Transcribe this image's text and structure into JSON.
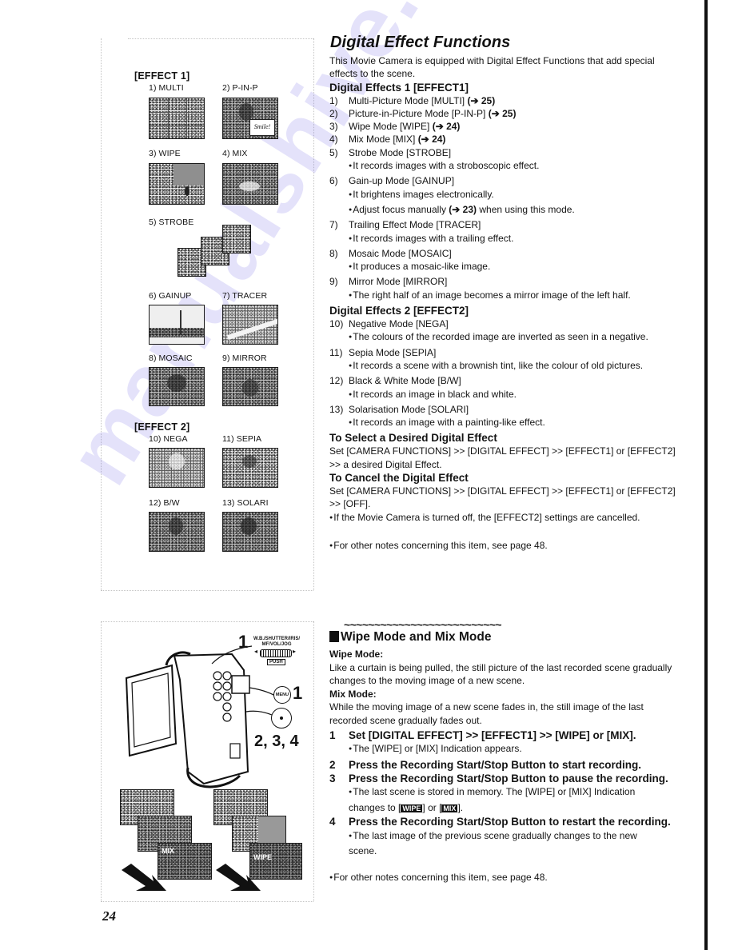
{
  "page_number": "24",
  "watermark": "manualshive.com",
  "left_panel": {
    "effect1_title": "[EFFECT 1]",
    "effect2_title": "[EFFECT 2]",
    "thumbnails": [
      {
        "label": "1) MULTI"
      },
      {
        "label": "2) P-IN-P",
        "inset_text": "Smile!"
      },
      {
        "label": "3) WIPE"
      },
      {
        "label": "4) MIX"
      },
      {
        "label": "5) STROBE"
      },
      {
        "label": "6) GAINUP"
      },
      {
        "label": "7) TRACER"
      },
      {
        "label": "8) MOSAIC"
      },
      {
        "label": "9) MIRROR"
      },
      {
        "label": "10) NEGA"
      },
      {
        "label": "11) SEPIA"
      },
      {
        "label": "12) B/W"
      },
      {
        "label": "13) SOLARI"
      }
    ]
  },
  "camera_diagram": {
    "callout_1_top": "1",
    "dial_label": "W.B./SHUTTER/IRIS/ MF/VOL/JOG",
    "push_label": "PUSH",
    "menu_button": "MENU",
    "callout_menu": "1",
    "callout_record": "2, 3, 4",
    "mix_overlay": "MIX",
    "wipe_overlay": "WIPE"
  },
  "main": {
    "title": "Digital Effect Functions",
    "intro": "This Movie Camera is equipped with Digital Effect Functions that add special effects to the scene.",
    "effects1_heading": "Digital Effects 1 [EFFECT1]",
    "effects1": [
      {
        "num": "1)",
        "text": "Multi-Picture Mode [MULTI] ",
        "ref": "(➔ 25)"
      },
      {
        "num": "2)",
        "text": "Picture-in-Picture Mode [P-IN-P] ",
        "ref": "(➔ 25)"
      },
      {
        "num": "3)",
        "text": "Wipe Mode [WIPE] ",
        "ref": "(➔ 24)"
      },
      {
        "num": "4)",
        "text": "Mix Mode [MIX] ",
        "ref": "(➔ 24)"
      },
      {
        "num": "5)",
        "text": "Strobe Mode [STROBE]",
        "notes": [
          "It records images with a stroboscopic effect."
        ]
      },
      {
        "num": "6)",
        "text": "Gain-up Mode [GAINUP]",
        "notes": [
          "It brightens images electronically."
        ],
        "note_focus_pre": "Adjust focus manually ",
        "note_focus_ref": "(➔ 23)",
        "note_focus_post": " when using this mode."
      },
      {
        "num": "7)",
        "text": "Trailing Effect Mode [TRACER]",
        "notes": [
          "It records images with a trailing effect."
        ]
      },
      {
        "num": "8)",
        "text": "Mosaic Mode [MOSAIC]",
        "notes": [
          "It produces a mosaic-like image."
        ]
      },
      {
        "num": "9)",
        "text": "Mirror Mode [MIRROR]",
        "notes": [
          "The right half of an image becomes a mirror image of the left half."
        ]
      }
    ],
    "effects2_heading": "Digital Effects 2  [EFFECT2]",
    "effects2": [
      {
        "num": "10)",
        "text": "Negative Mode [NEGA]",
        "note": "The colours of the recorded image are inverted as seen in a negative."
      },
      {
        "num": "11)",
        "text": "Sepia Mode [SEPIA]",
        "note": "It records a scene with a brownish tint, like the colour of old pictures."
      },
      {
        "num": "12)",
        "text": "Black & White Mode [B/W]",
        "note": "It records an image in black and white."
      },
      {
        "num": "13)",
        "text": "Solarisation Mode [SOLARI]",
        "note": "It records an image with a painting-like effect."
      }
    ],
    "select_heading": "To Select a Desired Digital Effect",
    "select_text": "Set [CAMERA FUNCTIONS] >> [DIGITAL EFFECT] >> [EFFECT1] or [EFFECT2] >> a desired Digital Effect.",
    "cancel_heading": "To Cancel the Digital Effect",
    "cancel_text": "Set [CAMERA FUNCTIONS] >> [DIGITAL EFFECT] >> [EFFECT1] or [EFFECT2] >> [OFF].",
    "cancel_note": "If the Movie Camera is turned off, the [EFFECT2] settings are cancelled.",
    "other_notes": "For other notes concerning this item, see page 48."
  },
  "wipe_mix": {
    "divider": "~~~~~~~~~~~~~~~~~~~~~~~~~~",
    "title": "Wipe Mode and Mix Mode",
    "wipe_heading": "Wipe Mode:",
    "wipe_text": "Like a curtain is being pulled, the still picture of the last recorded scene gradually changes to the moving image of a new scene.",
    "mix_heading": "Mix Mode:",
    "mix_text": "While the moving image of a new scene fades in, the still image of the last recorded scene gradually fades out.",
    "steps": [
      {
        "num": "1",
        "text": "Set [DIGITAL EFFECT] >> [EFFECT1] >> [WIPE] or [MIX].",
        "note": "The [WIPE] or [MIX] Indication appears."
      },
      {
        "num": "2",
        "text": "Press the Recording Start/Stop Button to start recording."
      },
      {
        "num": "3",
        "text": "Press the Recording Start/Stop Button to pause the recording.",
        "note_pre": "The last scene is stored in memory. The [WIPE] or [MIX] Indication changes to [",
        "tag_wipe": "WIPE",
        "note_mid": "] or [",
        "tag_mix": "MIX",
        "note_post": "]."
      },
      {
        "num": "4",
        "text": "Press the Recording Start/Stop Button to restart the recording.",
        "note": "The last image of the previous scene gradually changes to the new scene."
      }
    ],
    "other_notes": "For other notes concerning this item, see page 48."
  }
}
